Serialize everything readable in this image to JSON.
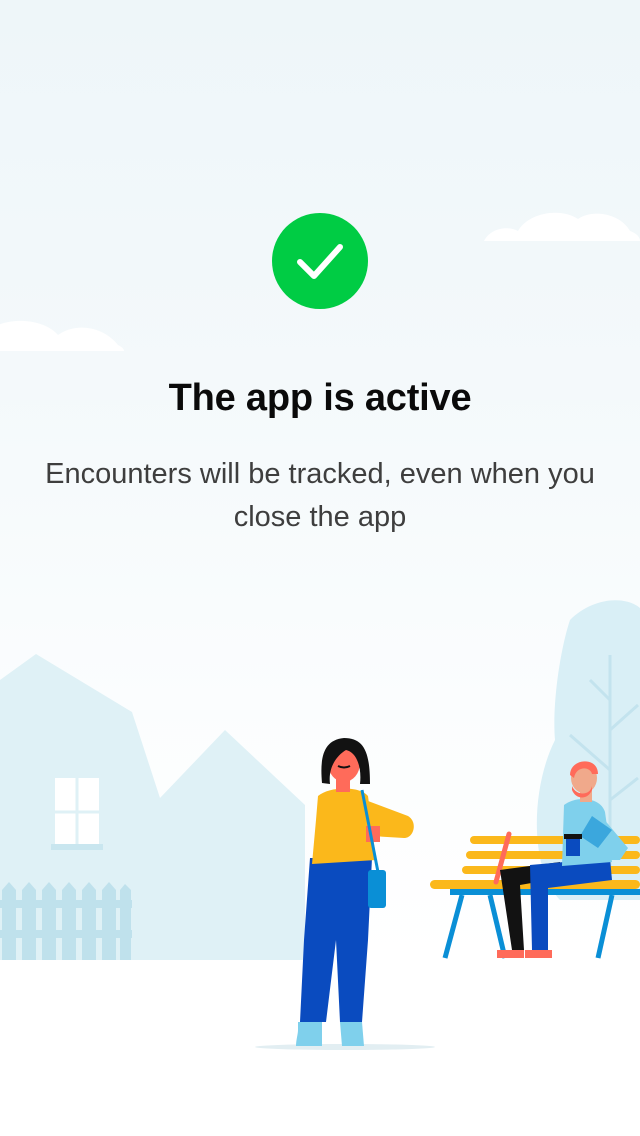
{
  "status": {
    "icon": "checkmark-circle-icon",
    "color": "#00cc44",
    "state": "active"
  },
  "title": "The app is active",
  "subtitle": "Encounters will be tracked, even when you close the app",
  "illustration": {
    "scene": "park-scene-illustration",
    "colors": {
      "sky": "#eef6f9",
      "building": "#dcf0f4",
      "accent_yellow": "#fbb81b",
      "accent_blue": "#0a4bbf"
    }
  }
}
